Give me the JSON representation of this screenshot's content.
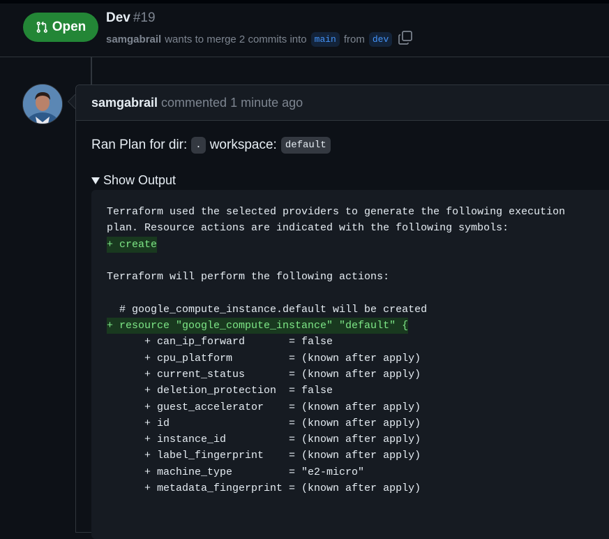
{
  "pr": {
    "state_label": "Open",
    "title": "Dev",
    "number": "#19",
    "author": "samgabrail",
    "merge_text": "wants to merge 2 commits into",
    "base_branch": "main",
    "from_text": "from",
    "head_branch": "dev"
  },
  "comment": {
    "author": "samgabrail",
    "action": "commented",
    "time": "1 minute ago",
    "ran_prefix": "Ran Plan for dir:",
    "dir_value": ".",
    "workspace_label": "workspace:",
    "workspace_value": "default",
    "summary_label": "Show Output"
  },
  "output_lines": [
    {
      "text": "Terraform used the selected providers to generate the following execution",
      "added": false
    },
    {
      "text": "plan. Resource actions are indicated with the following symbols:",
      "added": false
    },
    {
      "text": "+ create",
      "added": true
    },
    {
      "text": "",
      "added": false
    },
    {
      "text": "Terraform will perform the following actions:",
      "added": false
    },
    {
      "text": "",
      "added": false
    },
    {
      "text": "  # google_compute_instance.default will be created",
      "added": false
    },
    {
      "text": "+ resource \"google_compute_instance\" \"default\" {",
      "added": true
    },
    {
      "text": "      + can_ip_forward       = false",
      "added": false
    },
    {
      "text": "      + cpu_platform         = (known after apply)",
      "added": false
    },
    {
      "text": "      + current_status       = (known after apply)",
      "added": false
    },
    {
      "text": "      + deletion_protection  = false",
      "added": false
    },
    {
      "text": "      + guest_accelerator    = (known after apply)",
      "added": false
    },
    {
      "text": "      + id                   = (known after apply)",
      "added": false
    },
    {
      "text": "      + instance_id          = (known after apply)",
      "added": false
    },
    {
      "text": "      + label_fingerprint    = (known after apply)",
      "added": false
    },
    {
      "text": "      + machine_type         = \"e2-micro\"",
      "added": false
    },
    {
      "text": "      + metadata_fingerprint = (known after apply)",
      "added": false
    }
  ],
  "icons": {
    "state": "git-pull-request-icon",
    "copy": "copy-icon",
    "avatar": "avatar",
    "disclosure": "triangle-down-icon"
  },
  "colors": {
    "open_green": "#238636",
    "branch_blue": "#4493f8",
    "diff_add_bg": "#19391f",
    "diff_add_fg": "#7ee787"
  }
}
